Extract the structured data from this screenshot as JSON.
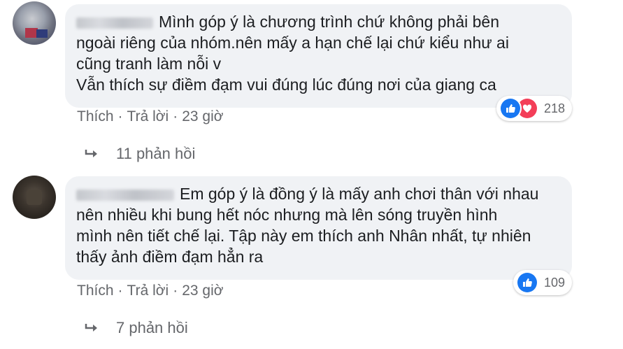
{
  "comments": [
    {
      "text_lines": [
        "Mình góp ý là chương trình chứ không phải bên",
        "ngoài riêng của nhóm.nên mấy a hạn chế lại chứ kiểu như ai",
        "cũng tranh làm nỗi v",
        "Vẫn thích sự điềm đạm vui đúng lúc đúng nơi của giang ca"
      ],
      "actions": {
        "like": "Thích",
        "separator": "·",
        "reply": "Trả lời",
        "time": "23 giờ"
      },
      "reactions": {
        "icons": [
          "like-icon",
          "love-icon"
        ],
        "count": "218"
      },
      "replies": {
        "label": "11 phản hồi"
      }
    },
    {
      "text_lines": [
        "Em góp ý là đồng ý là mấy anh chơi thân với nhau",
        "nên nhiều khi bung hết nóc nhưng mà lên sóng truyền hình",
        "mình nên tiết chế lại. Tập này em thích anh Nhân nhất, tự nhiên",
        "thấy ảnh điềm đạm hẳn ra"
      ],
      "actions": {
        "like": "Thích",
        "separator": "·",
        "reply": "Trả lời",
        "time": "23 giờ"
      },
      "reactions": {
        "icons": [
          "like-icon"
        ],
        "count": "109"
      },
      "replies": {
        "label": "7 phản hồi"
      }
    }
  ],
  "colors": {
    "bubble": "#f0f2f5",
    "like": "#1877f2",
    "love": "#f33e58",
    "meta": "#65676b"
  }
}
